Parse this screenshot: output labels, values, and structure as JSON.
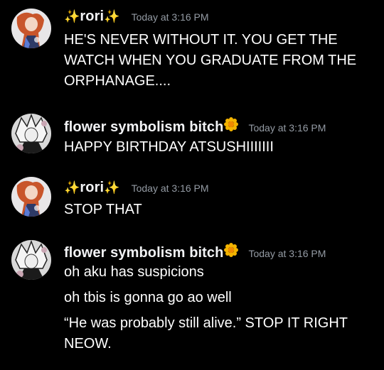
{
  "messages": [
    {
      "user": "rori",
      "user_prefix": "✨",
      "user_suffix": "✨",
      "timestamp": "Today at 3:16 PM",
      "lines": [
        "HE'S NEVER WITHOUT IT. YOU GET THE WATCH WHEN YOU GRADUATE FROM THE ORPHANAGE...."
      ]
    },
    {
      "user": "flower symbolism bitch",
      "timestamp": "Today at 3:16 PM",
      "lines": [
        "HAPPY BIRTHDAY ATSUSHIIIIIII"
      ]
    },
    {
      "user": "rori",
      "user_prefix": "✨",
      "user_suffix": "✨",
      "timestamp": "Today at 3:16 PM",
      "lines": [
        "STOP THAT"
      ]
    },
    {
      "user": "flower symbolism bitch",
      "timestamp": "Today at 3:16 PM",
      "lines": [
        "oh aku has suspicions",
        "oh tbis is gonna go ao well",
        "“He was probably still alive.” STOP IT RIGHT NEOW."
      ]
    }
  ],
  "icons": {
    "sparkle": "sparkle-icon",
    "flower": "sunflower-icon",
    "avatar_rori": "avatar-orange-hair-character",
    "avatar_flower": "avatar-white-hair-character"
  },
  "colors": {
    "background": "#000000",
    "username": "#f2f3f5",
    "timestamp": "#949ba4",
    "message": "#ffffff",
    "sparkle": "#f5c542"
  }
}
